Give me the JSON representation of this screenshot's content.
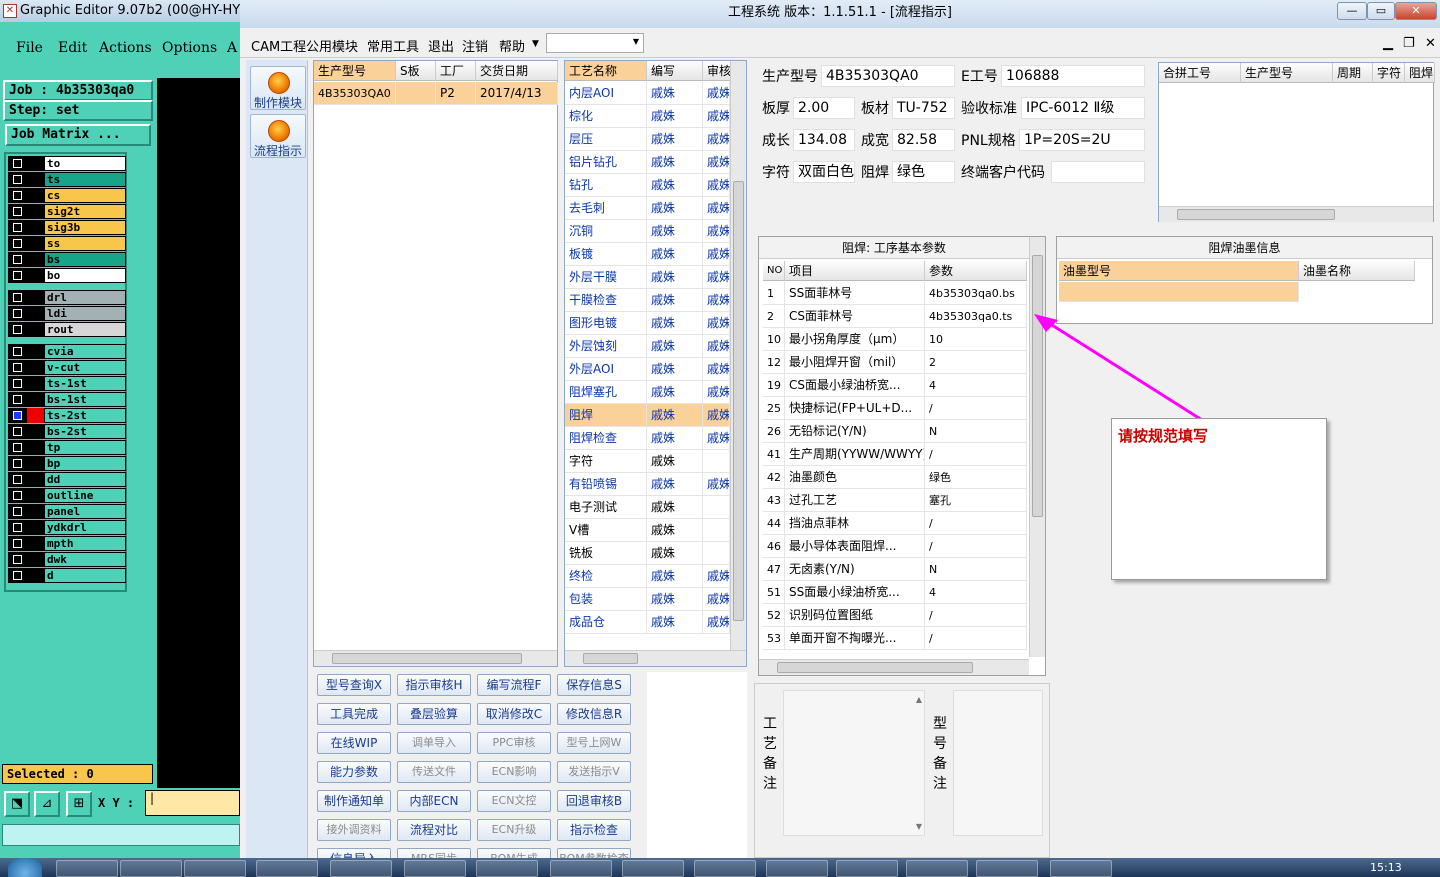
{
  "ge": {
    "title": "Graphic Editor 9.07b2 (00@HY-HYCA",
    "menu": [
      "File",
      "Edit",
      "Actions",
      "Options",
      "A"
    ],
    "job": "Job  : 4b35303qa0",
    "step": "Step: set",
    "matrix": "Job Matrix ...",
    "selected": "Selected : 0",
    "xy_label": "X Y :",
    "xy_value": "|"
  },
  "layers": [
    {
      "name": "to",
      "color": "#ffffff"
    },
    {
      "name": "ts",
      "color": "#17a589"
    },
    {
      "name": "cs",
      "color": "#f7c64b"
    },
    {
      "name": "sig2t",
      "color": "#f7c64b"
    },
    {
      "name": "sig3b",
      "color": "#f7c64b"
    },
    {
      "name": "ss",
      "color": "#f7c64b"
    },
    {
      "name": "bs",
      "color": "#17a589"
    },
    {
      "name": "bo",
      "color": "#ffffff"
    },
    {
      "name": "drl",
      "color": "#a3b1b5"
    },
    {
      "name": "ldi",
      "color": "#a3b1b5"
    },
    {
      "name": "rout",
      "color": "#d7d7d7"
    },
    {
      "name": "cvia",
      "color": "#4fd1b8"
    },
    {
      "name": "v-cut",
      "color": "#4fd1b8"
    },
    {
      "name": "ts-1st",
      "color": "#4fd1b8"
    },
    {
      "name": "bs-1st",
      "color": "#4fd1b8"
    },
    {
      "name": "ts-2st",
      "color": "#4fd1b8"
    },
    {
      "name": "bs-2st",
      "color": "#4fd1b8"
    },
    {
      "name": "tp",
      "color": "#4fd1b8"
    },
    {
      "name": "bp",
      "color": "#4fd1b8"
    },
    {
      "name": "dd",
      "color": "#4fd1b8"
    },
    {
      "name": "outline",
      "color": "#4fd1b8"
    },
    {
      "name": "panel",
      "color": "#4fd1b8"
    },
    {
      "name": "ydkdrl",
      "color": "#4fd1b8"
    },
    {
      "name": "mpth",
      "color": "#4fd1b8"
    },
    {
      "name": "dwk",
      "color": "#4fd1b8"
    },
    {
      "name": "d",
      "color": "#4fd1b8"
    }
  ],
  "mw": {
    "title": "工程系统   版本：1.1.51.1 - [流程指示]",
    "menu": [
      "CAM工程",
      "公用模块",
      "常用工具",
      "退出",
      "注销",
      "帮助"
    ],
    "nav": [
      "制作模块",
      "流程指示"
    ]
  },
  "jobs": {
    "headers": [
      "生产型号",
      "S板",
      "工厂",
      "交货日期"
    ],
    "rows": [
      [
        "4B35303QA0",
        "",
        "P2",
        "2017/4/13"
      ]
    ]
  },
  "process": {
    "headers": [
      "工艺名称",
      "编写",
      "审核"
    ],
    "rows": [
      [
        "内层AOI",
        "戚姝",
        "戚姝"
      ],
      [
        "棕化",
        "戚姝",
        "戚姝"
      ],
      [
        "层压",
        "戚姝",
        "戚姝"
      ],
      [
        "铝片钻孔",
        "戚姝",
        "戚姝"
      ],
      [
        "钻孔",
        "戚姝",
        "戚姝"
      ],
      [
        "去毛刺",
        "戚姝",
        "戚姝"
      ],
      [
        "沉铜",
        "戚姝",
        "戚姝"
      ],
      [
        "板镀",
        "戚姝",
        "戚姝"
      ],
      [
        "外层干膜",
        "戚姝",
        "戚姝"
      ],
      [
        "干膜检查",
        "戚姝",
        "戚姝"
      ],
      [
        "图形电镀",
        "戚姝",
        "戚姝"
      ],
      [
        "外层蚀刻",
        "戚姝",
        "戚姝"
      ],
      [
        "外层AOI",
        "戚姝",
        "戚姝"
      ],
      [
        "阻焊塞孔",
        "戚姝",
        "戚姝"
      ],
      [
        "阻焊",
        "戚姝",
        "戚姝"
      ],
      [
        "阻焊检查",
        "戚姝",
        "戚姝"
      ],
      [
        "字符",
        "戚姝",
        ""
      ],
      [
        "有铅喷锡",
        "戚姝",
        "戚姝"
      ],
      [
        "电子测试",
        "戚姝",
        ""
      ],
      [
        "V槽",
        "戚姝",
        ""
      ],
      [
        "铣板",
        "戚姝",
        ""
      ],
      [
        "终检",
        "戚姝",
        "戚姝"
      ],
      [
        "包装",
        "戚姝",
        "戚姝"
      ],
      [
        "成品仓",
        "戚姝",
        "戚姝"
      ]
    ],
    "selected_index": 14
  },
  "buttons": [
    [
      "型号查询X",
      "指示审核H",
      "编写流程F",
      "保存信息S"
    ],
    [
      "工具完成",
      "叠层验算",
      "取消修改C",
      "修改信息R"
    ],
    [
      "在线WIP",
      "调单导入",
      "PPC审核",
      "型号上网W"
    ],
    [
      "能力参数",
      "传送文件",
      "ECN影响",
      "发送指示V"
    ],
    [
      "制作通知单",
      "内部ECN",
      "ECN文控",
      "回退审核B"
    ],
    [
      "接外调资料",
      "流程对比",
      "ECN升级",
      "指示检查"
    ],
    [
      "信息导入",
      "MRS同步",
      "BOM生成",
      "BOM参数检查"
    ]
  ],
  "disabled_buttons": [
    "调单导入",
    "PPC审核",
    "型号上网W",
    "传送文件",
    "ECN影响",
    "发送指示V",
    "ECN文控",
    "接外调资料",
    "ECN升级",
    "MRS同步",
    "BOM生成",
    "BOM参数检查"
  ],
  "info": {
    "model_label": "生产型号",
    "model": "4B35303QA0",
    "eno_label": "E工号",
    "eno": "106888",
    "thick_label": "板厚",
    "thick": "2.00",
    "mat_label": "板材",
    "mat": "TU-752",
    "std_label": "验收标准",
    "std": "IPC-6012 Ⅱ级",
    "len_label": "成长",
    "len": "134.08",
    "wid_label": "成宽",
    "wid": "82.58",
    "pnl_label": "PNL规格",
    "pnl": "1P=20S=2U",
    "char_label": "字符",
    "char": "双面白色",
    "mask_label": "阻焊",
    "mask": "绿色",
    "cust_label": "终端客户代码",
    "cust": ""
  },
  "merge": {
    "headers": [
      "合拼工号",
      "生产型号",
      "周期",
      "字符",
      "阻焊"
    ]
  },
  "params": {
    "title": "阻焊: 工序基本参数",
    "headers": [
      "NO",
      "项目",
      "参数"
    ],
    "rows": [
      [
        "1",
        "SS面菲林号",
        "4b35303qa0.bs"
      ],
      [
        "2",
        "CS面菲林号",
        "4b35303qa0.ts"
      ],
      [
        "10",
        "最小拐角厚度（μm）",
        "10"
      ],
      [
        "12",
        "最小阻焊开窗（mil）",
        "2"
      ],
      [
        "19",
        "CS面最小绿油桥宽...",
        "4"
      ],
      [
        "25",
        "快捷标记(FP+UL+D...",
        "/"
      ],
      [
        "26",
        "无铅标记(Y/N)",
        "N"
      ],
      [
        "41",
        "生产周期(YYWW/WWYY)",
        "/"
      ],
      [
        "42",
        "油墨颜色",
        "绿色"
      ],
      [
        "43",
        "过孔工艺",
        "塞孔"
      ],
      [
        "44",
        "挡油点菲林",
        "/"
      ],
      [
        "46",
        "最小导体表面阻焊...",
        "/"
      ],
      [
        "47",
        "无卤素(Y/N)",
        "N"
      ],
      [
        "51",
        "SS面最小绿油桥宽...",
        "4"
      ],
      [
        "52",
        "识别码位置图纸",
        "/"
      ],
      [
        "53",
        "单面开窗不掏曝光...",
        "/"
      ]
    ]
  },
  "ink": {
    "title": "阻焊油墨信息",
    "headers": [
      "油墨型号",
      "油墨名称"
    ]
  },
  "remarks": {
    "process": "工艺备注",
    "model": "型号备注"
  },
  "note": "请按规范填写",
  "clock": "15:13",
  "colors": {
    "accent": "#fbd19a",
    "arrow": "#ff00ff",
    "note_text": "#cc0000"
  }
}
